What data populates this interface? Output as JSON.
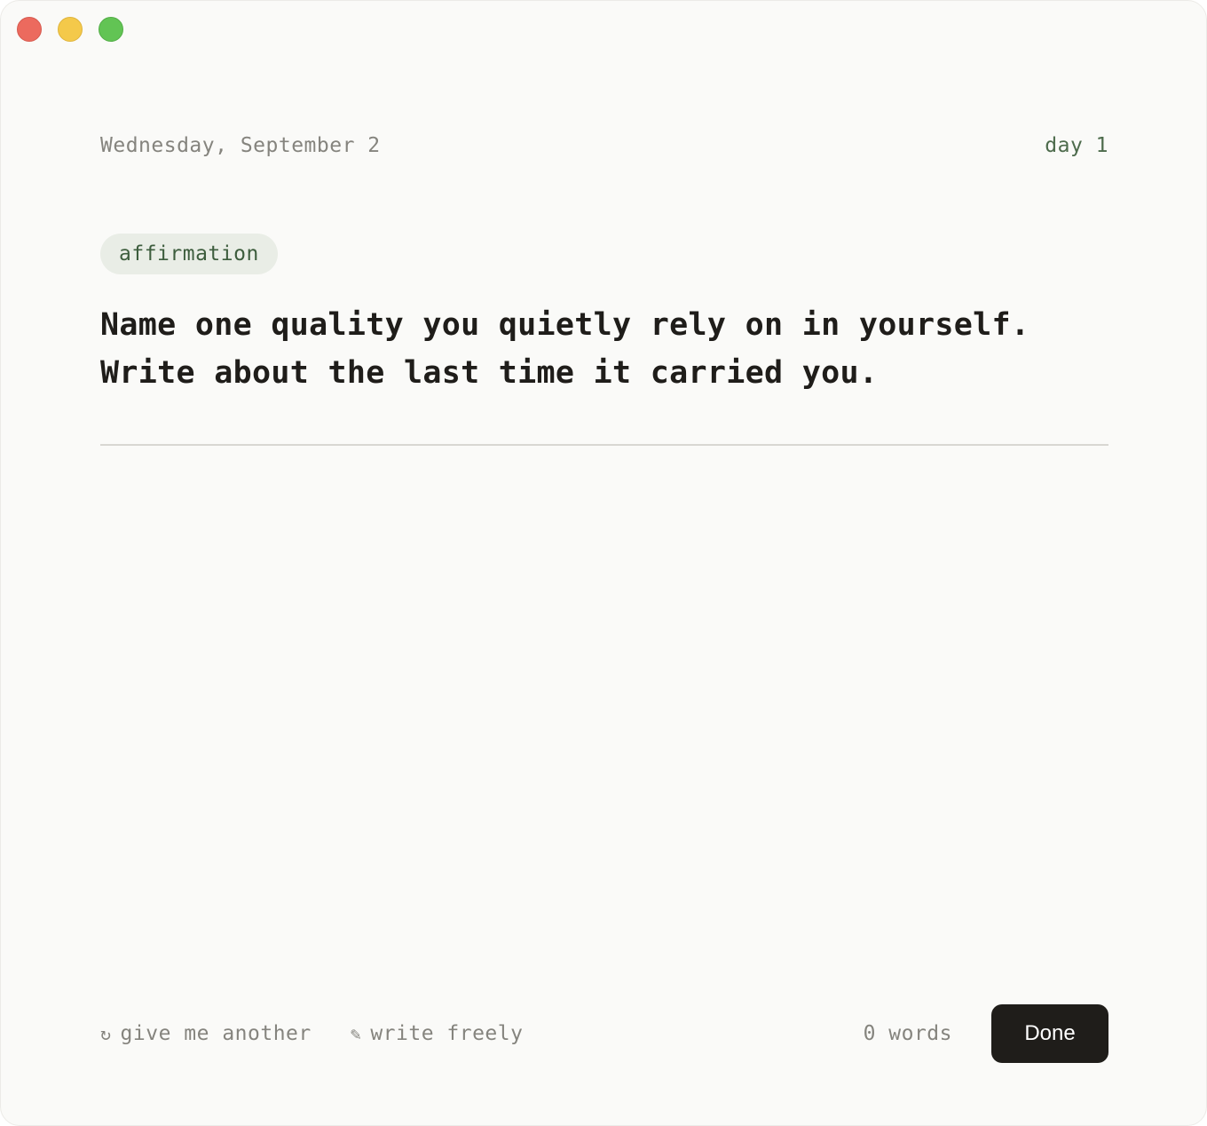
{
  "window": {
    "controls": [
      "close",
      "minimize",
      "zoom"
    ]
  },
  "header": {
    "date": "Wednesday, September 2",
    "day": "day 1"
  },
  "prompt": {
    "tag": "affirmation",
    "line1": "Name one quality you quietly rely on in yourself.",
    "line2": "Write about the last time it carried you."
  },
  "editor": {
    "value": "",
    "placeholder": ""
  },
  "footer": {
    "another": {
      "icon": "refresh-icon",
      "glyph": "↻",
      "label": "give me another"
    },
    "freely": {
      "icon": "pencil-icon",
      "glyph": "✎",
      "label": "write freely"
    },
    "word_count": "0 words",
    "done_label": "Done"
  },
  "colors": {
    "background": "#fafaf8",
    "accent_green": "#4d6b4c",
    "tag_bg": "#e9ede6",
    "muted_text": "#85847e",
    "primary_text": "#1f1d1a",
    "button_bg": "#1f1d1a"
  }
}
